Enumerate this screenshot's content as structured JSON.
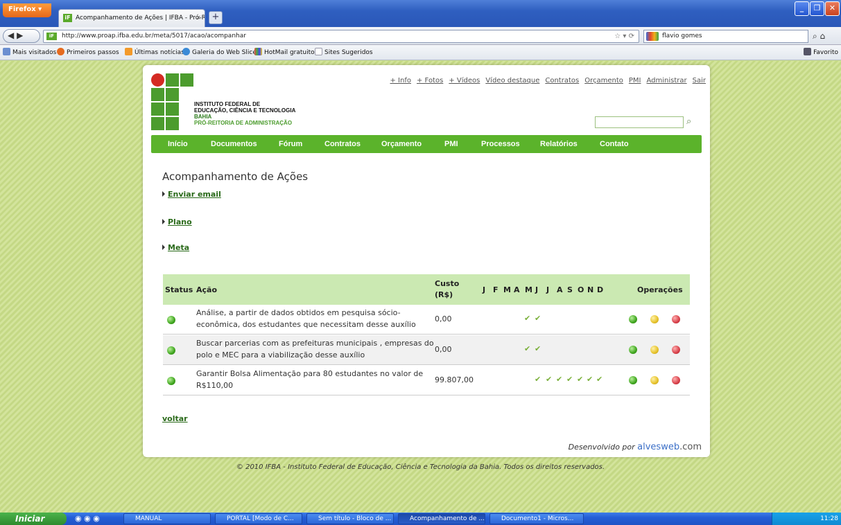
{
  "browser": {
    "menu_button": "Firefox",
    "tab_title": "Acompanhamento de Ações | IFBA - Pró-Rei...",
    "tab_close": "×",
    "new_tab": "+",
    "url": "http://www.proap.ifba.edu.br/meta/5017/acao/acompanhar",
    "search_value": "flavio gomes",
    "bookmarks": [
      "Mais visitados",
      "Primeiros passos",
      "Últimas notícias",
      "Galeria do Web Slice",
      "HotMail gratuito",
      "Sites Sugeridos"
    ],
    "favorites": "Favorito"
  },
  "site": {
    "logo_text": {
      "line1": "INSTITUTO FEDERAL DE",
      "line2": "EDUCAÇÃO, CIÊNCIA E TECNOLOGIA",
      "line3": "BAHIA",
      "line4": "PRÓ-REITORIA DE ADMINISTRAÇÃO"
    },
    "top_links": [
      "+ Info",
      "+ Fotos",
      "+ Vídeos",
      "Vídeo destaque",
      "Contratos",
      "Orçamento",
      "PMI",
      "Administrar",
      "Sair"
    ],
    "search_placeholder": "",
    "menu": [
      "Início",
      "Documentos",
      "Fórum",
      "Contratos",
      "Orçamento",
      "PMI",
      "Processos",
      "Relatórios",
      "Contato"
    ]
  },
  "page": {
    "title": "Acompanhamento de Ações",
    "links": [
      "Enviar email",
      "Plano",
      "Meta"
    ],
    "table": {
      "headers": {
        "status": "Status",
        "acao": "Ação",
        "custo_line1": "Custo",
        "custo_line2": "(R$)",
        "months": [
          "J",
          "F",
          "M",
          "A",
          "M",
          "J",
          "J",
          "A",
          "S",
          "O",
          "N",
          "D"
        ],
        "operacoes": "Operações"
      },
      "rows": [
        {
          "acao_line1": "Análise, a partir de dados obtidos em pesquisa sócio-",
          "acao_line2": "econômica, dos estudantes que necessitam desse auxílio",
          "custo": "0,00",
          "months_checked": [
            4,
            5
          ]
        },
        {
          "acao_line1": "Buscar parcerias com as prefeituras municipais , empresas do",
          "acao_line2": "polo e MEC para a viabilização desse auxílio",
          "custo": "0,00",
          "months_checked": [
            4,
            5
          ]
        },
        {
          "acao_line1": "Garantir Bolsa Alimentação para 80 estudantes no valor de",
          "acao_line2": "R$110,00",
          "custo": "99.807,00",
          "months_checked": [
            5,
            6,
            7,
            8,
            9,
            10,
            11
          ]
        }
      ]
    },
    "back_link": "voltar",
    "dev_prefix": "Desenvolvido por",
    "dev_brand": "alvesweb",
    "dev_suffix": ".com"
  },
  "footer": "© 2010 IFBA - Instituto Federal de Educação, Ciência e Tecnologia da Bahia. Todos os direitos reservados.",
  "taskbar": {
    "start": "Iniciar",
    "tasks": [
      "MANUAL",
      "PORTAL [Modo de C...",
      "Sem título - Bloco de ...",
      "Acompanhamento de ...",
      "Documento1 - Micros..."
    ],
    "clock": "11:28"
  }
}
